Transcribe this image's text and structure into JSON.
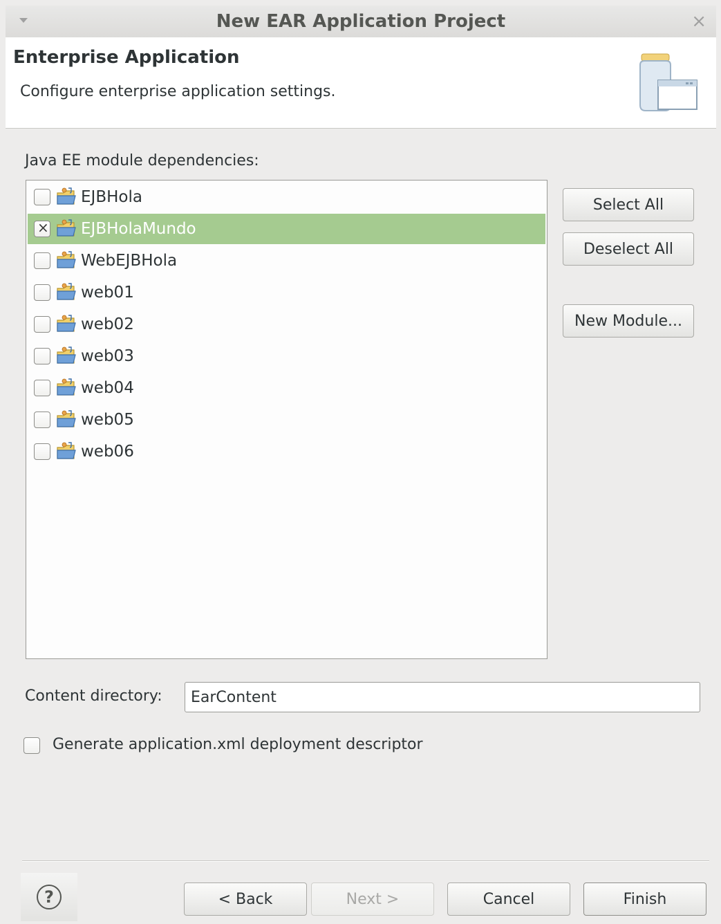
{
  "window": {
    "title": "New EAR Application Project",
    "close_glyph": "×"
  },
  "banner": {
    "heading": "Enterprise Application",
    "description": "Configure enterprise application settings.",
    "icon": "wizard-jar-icon"
  },
  "modules": {
    "label": "Java EE module dependencies:",
    "items": [
      {
        "label": "EJBHola",
        "checked": false,
        "selected": false
      },
      {
        "label": "EJBHolaMundo",
        "checked": true,
        "selected": true
      },
      {
        "label": "WebEJBHola",
        "checked": false,
        "selected": false
      },
      {
        "label": "web01",
        "checked": false,
        "selected": false
      },
      {
        "label": "web02",
        "checked": false,
        "selected": false
      },
      {
        "label": "web03",
        "checked": false,
        "selected": false
      },
      {
        "label": "web04",
        "checked": false,
        "selected": false
      },
      {
        "label": "web05",
        "checked": false,
        "selected": false
      },
      {
        "label": "web06",
        "checked": false,
        "selected": false
      }
    ],
    "item_icon": "project-folder-icon"
  },
  "side_buttons": {
    "select_all": "Select All",
    "deselect_all": "Deselect All",
    "new_module": "New Module..."
  },
  "content_directory": {
    "label": "Content directory:",
    "value": "EarContent"
  },
  "generate_descriptor": {
    "label": "Generate application.xml deployment descriptor",
    "checked": false
  },
  "footer": {
    "help_glyph": "?",
    "back": "< Back",
    "next": "Next >",
    "cancel": "Cancel",
    "finish": "Finish"
  },
  "colors": {
    "selection": "#a5cb90",
    "window_bg": "#edeceb"
  }
}
